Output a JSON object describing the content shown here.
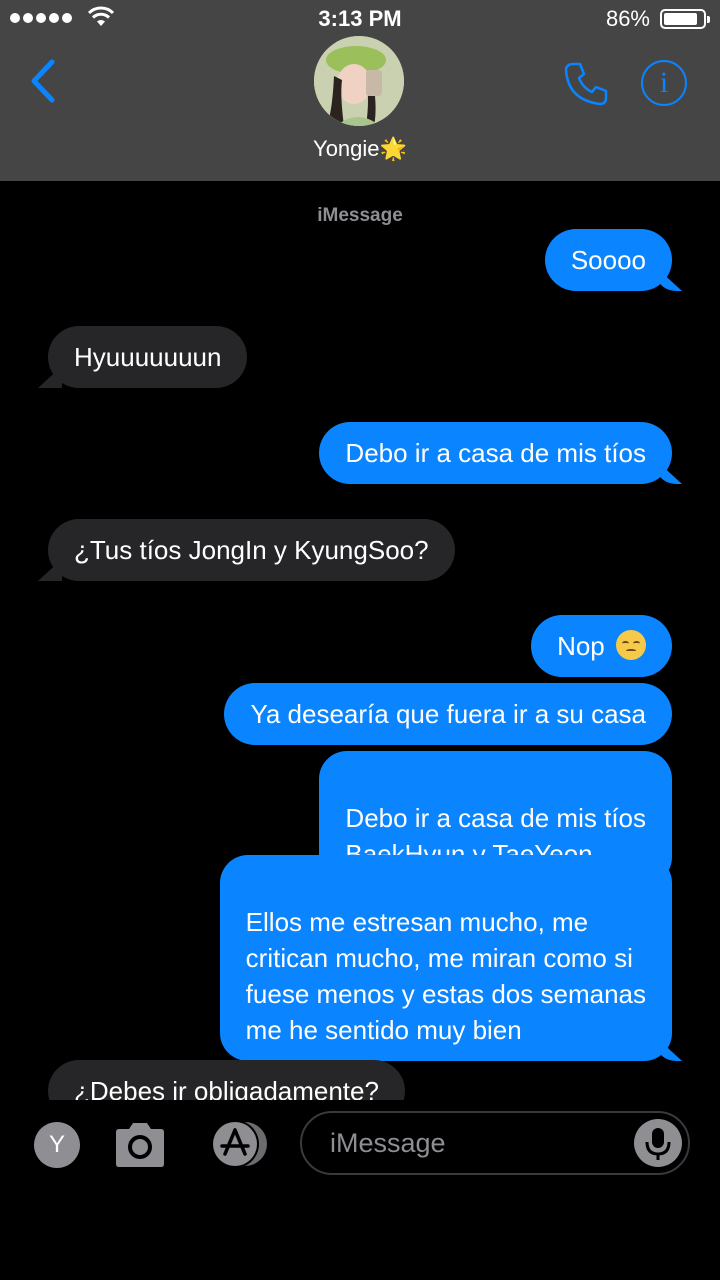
{
  "status_bar": {
    "time": "3:13 PM",
    "battery_percent": "86%",
    "signal_bars": 5,
    "battery_level": 0.86
  },
  "header": {
    "contact_name": "Yongie🌟",
    "back_icon": "chevron-left-icon",
    "call_icon": "phone-icon",
    "info_icon": "info-icon",
    "info_glyph": "i",
    "accent_color": "#0a84ff"
  },
  "thread": {
    "service_label": "iMessage",
    "messages": [
      {
        "from": "me",
        "text": "Soooo"
      },
      {
        "from": "them",
        "text": "Hyuuuuuuun"
      },
      {
        "from": "me",
        "text": "Debo ir a casa de mis tíos"
      },
      {
        "from": "them",
        "text": "¿Tus tíos JongIn y KyungSoo?"
      },
      {
        "from": "me",
        "text": "Nop"
      },
      {
        "from": "me",
        "text": "Ya desearía que fuera ir a su casa"
      },
      {
        "from": "me",
        "text": "Debo ir a casa de mis tíos\nBaekHyun y TaeYeon"
      },
      {
        "from": "me",
        "text": "Ellos me estresan mucho, me\ncritican mucho, me miran como si\nfuese menos y estas dos semanas\nme he sentido muy bien"
      },
      {
        "from": "them",
        "text": "¿Debes ir obligadamente?"
      }
    ],
    "emoji_after_nop": "pensive-face-emoji"
  },
  "input_bar": {
    "app_label": "Y",
    "placeholder": "iMessage",
    "camera_icon": "camera-icon",
    "appstore_icon": "app-store-icon",
    "mic_icon": "microphone-icon"
  }
}
